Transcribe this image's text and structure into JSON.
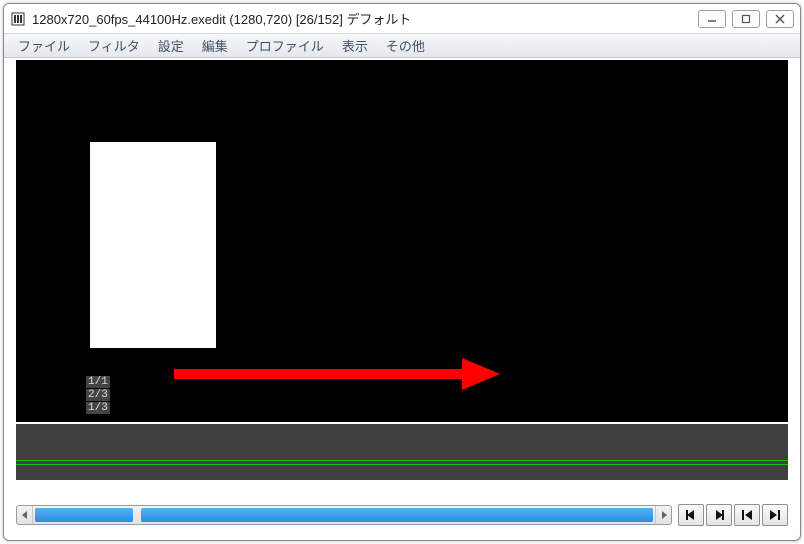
{
  "window": {
    "title": "1280x720_60fps_44100Hz.exedit (1280,720)  [26/152]  デフォルト"
  },
  "menu": {
    "items": [
      {
        "label": "ファイル"
      },
      {
        "label": "フィルタ"
      },
      {
        "label": "設定"
      },
      {
        "label": "編集"
      },
      {
        "label": "プロファイル"
      },
      {
        "label": "表示"
      },
      {
        "label": "その他"
      }
    ]
  },
  "preview": {
    "frame_info": [
      "1/1",
      "2/3",
      "1/3"
    ]
  },
  "playback": {
    "controls": [
      {
        "name": "step-back-button"
      },
      {
        "name": "step-forward-button"
      },
      {
        "name": "goto-start-button"
      },
      {
        "name": "goto-end-button"
      }
    ]
  },
  "colors": {
    "arrow": "#ff0000",
    "timeline_line": "#12c412",
    "thumb": "#2a8de0"
  }
}
